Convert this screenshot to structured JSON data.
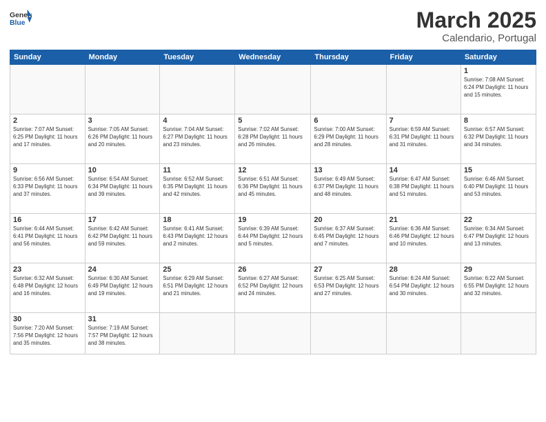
{
  "header": {
    "logo_general": "General",
    "logo_blue": "Blue",
    "month": "March 2025",
    "location": "Calendario, Portugal"
  },
  "days_of_week": [
    "Sunday",
    "Monday",
    "Tuesday",
    "Wednesday",
    "Thursday",
    "Friday",
    "Saturday"
  ],
  "weeks": [
    [
      {
        "day": "",
        "info": ""
      },
      {
        "day": "",
        "info": ""
      },
      {
        "day": "",
        "info": ""
      },
      {
        "day": "",
        "info": ""
      },
      {
        "day": "",
        "info": ""
      },
      {
        "day": "",
        "info": ""
      },
      {
        "day": "1",
        "info": "Sunrise: 7:08 AM\nSunset: 6:24 PM\nDaylight: 11 hours\nand 15 minutes."
      }
    ],
    [
      {
        "day": "2",
        "info": "Sunrise: 7:07 AM\nSunset: 6:25 PM\nDaylight: 11 hours\nand 17 minutes."
      },
      {
        "day": "3",
        "info": "Sunrise: 7:05 AM\nSunset: 6:26 PM\nDaylight: 11 hours\nand 20 minutes."
      },
      {
        "day": "4",
        "info": "Sunrise: 7:04 AM\nSunset: 6:27 PM\nDaylight: 11 hours\nand 23 minutes."
      },
      {
        "day": "5",
        "info": "Sunrise: 7:02 AM\nSunset: 6:28 PM\nDaylight: 11 hours\nand 26 minutes."
      },
      {
        "day": "6",
        "info": "Sunrise: 7:00 AM\nSunset: 6:29 PM\nDaylight: 11 hours\nand 28 minutes."
      },
      {
        "day": "7",
        "info": "Sunrise: 6:59 AM\nSunset: 6:31 PM\nDaylight: 11 hours\nand 31 minutes."
      },
      {
        "day": "8",
        "info": "Sunrise: 6:57 AM\nSunset: 6:32 PM\nDaylight: 11 hours\nand 34 minutes."
      }
    ],
    [
      {
        "day": "9",
        "info": "Sunrise: 6:56 AM\nSunset: 6:33 PM\nDaylight: 11 hours\nand 37 minutes."
      },
      {
        "day": "10",
        "info": "Sunrise: 6:54 AM\nSunset: 6:34 PM\nDaylight: 11 hours\nand 39 minutes."
      },
      {
        "day": "11",
        "info": "Sunrise: 6:52 AM\nSunset: 6:35 PM\nDaylight: 11 hours\nand 42 minutes."
      },
      {
        "day": "12",
        "info": "Sunrise: 6:51 AM\nSunset: 6:36 PM\nDaylight: 11 hours\nand 45 minutes."
      },
      {
        "day": "13",
        "info": "Sunrise: 6:49 AM\nSunset: 6:37 PM\nDaylight: 11 hours\nand 48 minutes."
      },
      {
        "day": "14",
        "info": "Sunrise: 6:47 AM\nSunset: 6:38 PM\nDaylight: 11 hours\nand 51 minutes."
      },
      {
        "day": "15",
        "info": "Sunrise: 6:46 AM\nSunset: 6:40 PM\nDaylight: 11 hours\nand 53 minutes."
      }
    ],
    [
      {
        "day": "16",
        "info": "Sunrise: 6:44 AM\nSunset: 6:41 PM\nDaylight: 11 hours\nand 56 minutes."
      },
      {
        "day": "17",
        "info": "Sunrise: 6:42 AM\nSunset: 6:42 PM\nDaylight: 11 hours\nand 59 minutes."
      },
      {
        "day": "18",
        "info": "Sunrise: 6:41 AM\nSunset: 6:43 PM\nDaylight: 12 hours\nand 2 minutes."
      },
      {
        "day": "19",
        "info": "Sunrise: 6:39 AM\nSunset: 6:44 PM\nDaylight: 12 hours\nand 5 minutes."
      },
      {
        "day": "20",
        "info": "Sunrise: 6:37 AM\nSunset: 6:45 PM\nDaylight: 12 hours\nand 7 minutes."
      },
      {
        "day": "21",
        "info": "Sunrise: 6:36 AM\nSunset: 6:46 PM\nDaylight: 12 hours\nand 10 minutes."
      },
      {
        "day": "22",
        "info": "Sunrise: 6:34 AM\nSunset: 6:47 PM\nDaylight: 12 hours\nand 13 minutes."
      }
    ],
    [
      {
        "day": "23",
        "info": "Sunrise: 6:32 AM\nSunset: 6:48 PM\nDaylight: 12 hours\nand 16 minutes."
      },
      {
        "day": "24",
        "info": "Sunrise: 6:30 AM\nSunset: 6:49 PM\nDaylight: 12 hours\nand 19 minutes."
      },
      {
        "day": "25",
        "info": "Sunrise: 6:29 AM\nSunset: 6:51 PM\nDaylight: 12 hours\nand 21 minutes."
      },
      {
        "day": "26",
        "info": "Sunrise: 6:27 AM\nSunset: 6:52 PM\nDaylight: 12 hours\nand 24 minutes."
      },
      {
        "day": "27",
        "info": "Sunrise: 6:25 AM\nSunset: 6:53 PM\nDaylight: 12 hours\nand 27 minutes."
      },
      {
        "day": "28",
        "info": "Sunrise: 6:24 AM\nSunset: 6:54 PM\nDaylight: 12 hours\nand 30 minutes."
      },
      {
        "day": "29",
        "info": "Sunrise: 6:22 AM\nSunset: 6:55 PM\nDaylight: 12 hours\nand 32 minutes."
      }
    ],
    [
      {
        "day": "30",
        "info": "Sunrise: 7:20 AM\nSunset: 7:56 PM\nDaylight: 12 hours\nand 35 minutes."
      },
      {
        "day": "31",
        "info": "Sunrise: 7:19 AM\nSunset: 7:57 PM\nDaylight: 12 hours\nand 38 minutes."
      },
      {
        "day": "",
        "info": ""
      },
      {
        "day": "",
        "info": ""
      },
      {
        "day": "",
        "info": ""
      },
      {
        "day": "",
        "info": ""
      },
      {
        "day": "",
        "info": ""
      }
    ]
  ]
}
